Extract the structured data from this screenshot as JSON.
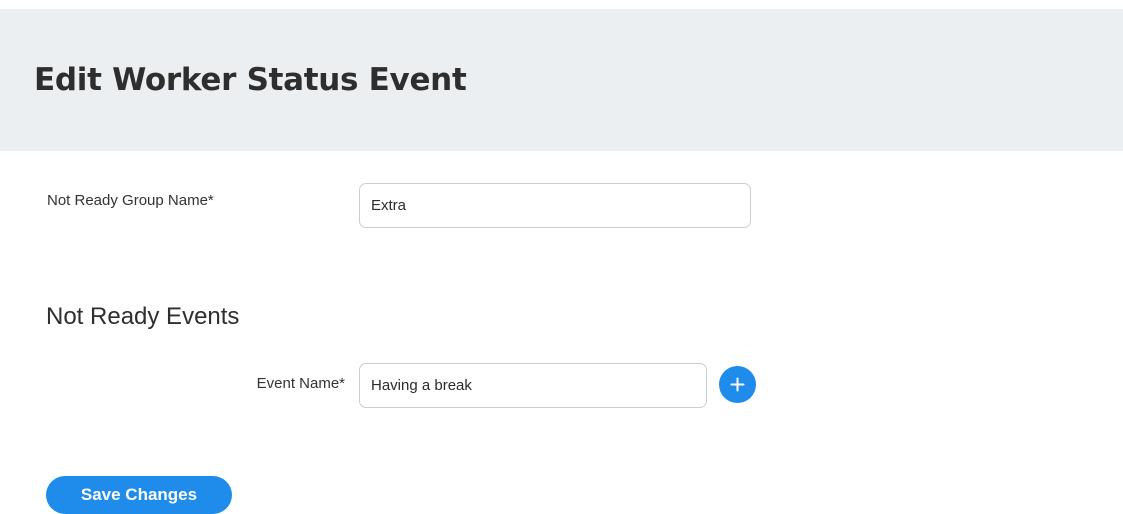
{
  "header": {
    "title": "Edit Worker Status Event"
  },
  "form": {
    "group_name": {
      "label": "Not Ready Group Name*",
      "value": "Extra"
    },
    "events_section": {
      "heading": "Not Ready Events",
      "event_name": {
        "label": "Event Name*",
        "value": "Having a break"
      },
      "add_icon": "plus-icon"
    },
    "save_label": "Save Changes"
  },
  "colors": {
    "header_background": "#eceff2",
    "accent": "#1f8cec",
    "input_border": "#c9ced4"
  }
}
